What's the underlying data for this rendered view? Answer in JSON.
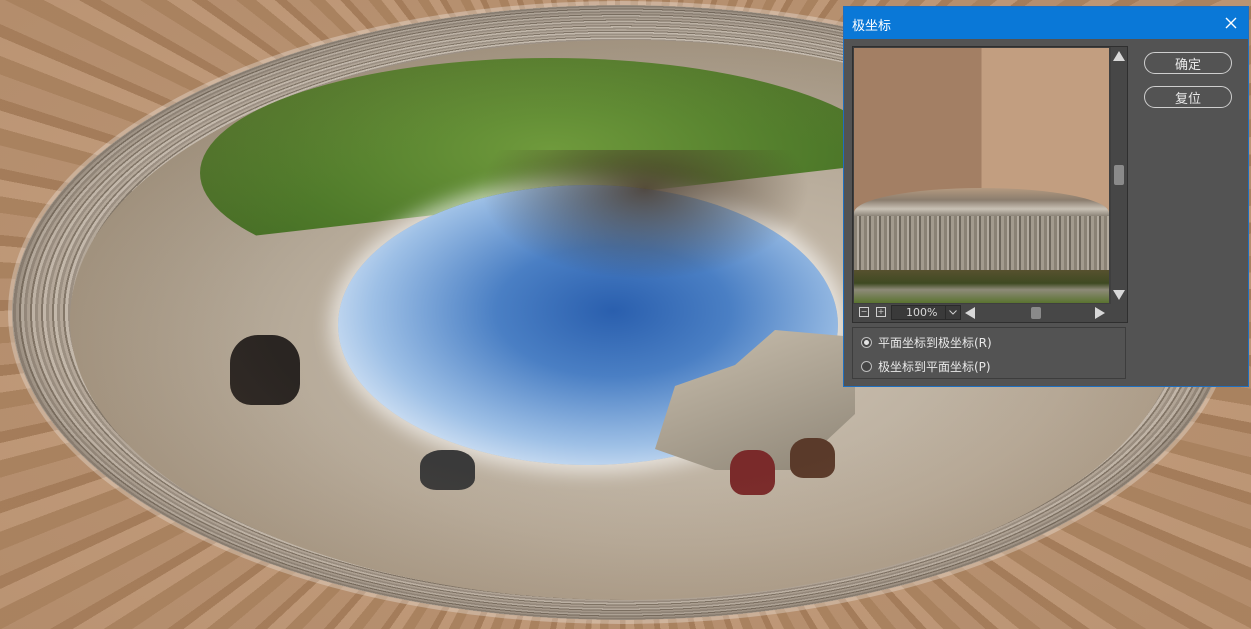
{
  "canvas": {
    "description_icon": "polar-distorted-photo"
  },
  "dialog": {
    "title": "极坐标",
    "close_icon": "close-icon",
    "zoom_value": "100%",
    "zoom_out_symbol": "−",
    "zoom_in_symbol": "+",
    "buttons": {
      "ok": "确定",
      "reset": "复位"
    },
    "options": [
      {
        "label": "平面坐标到极坐标(R)",
        "selected": true
      },
      {
        "label": "极坐标到平面坐标(P)",
        "selected": false
      }
    ],
    "colors": {
      "titlebar": "#0a78d7",
      "panel": "#535353"
    }
  }
}
